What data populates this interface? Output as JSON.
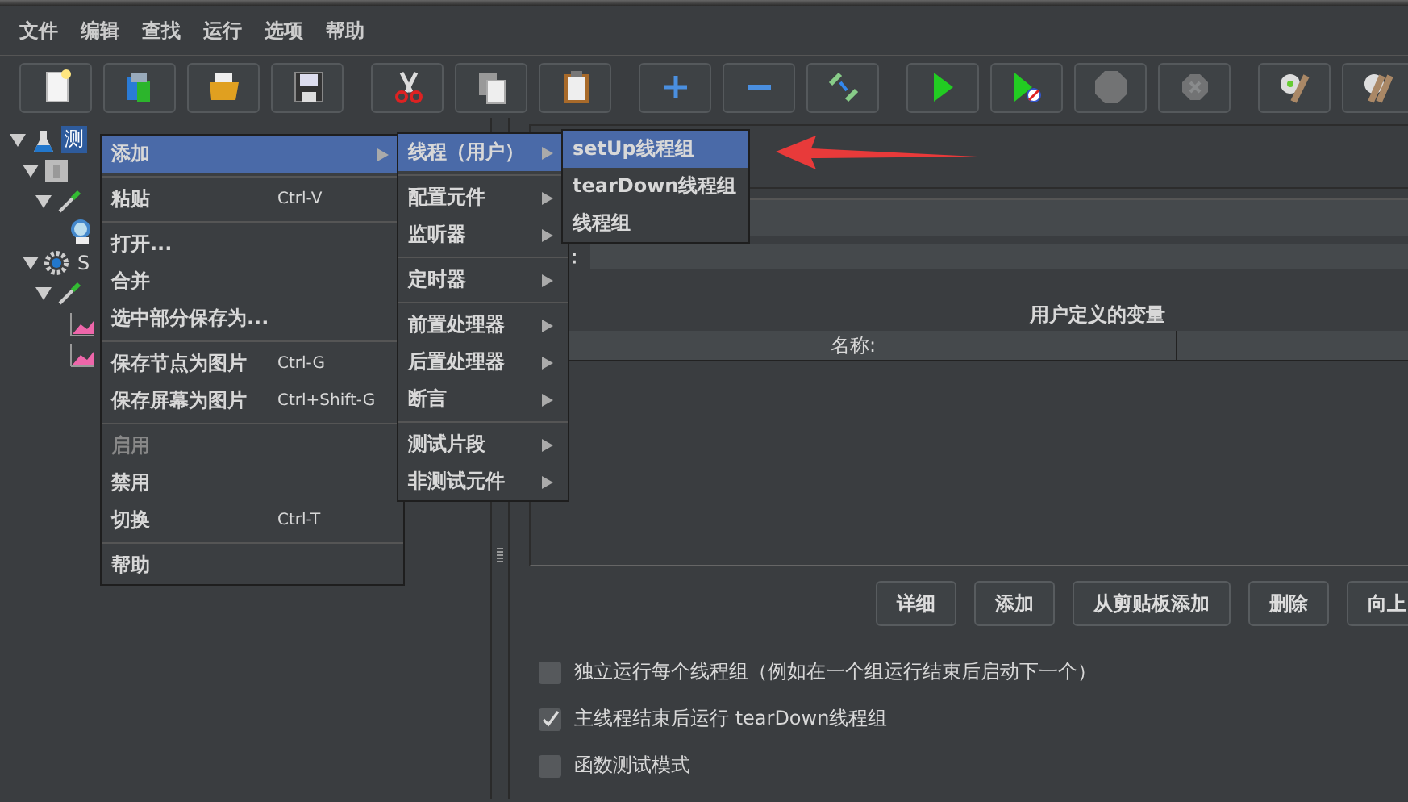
{
  "menu_bar": [
    "文件",
    "编辑",
    "查找",
    "运行",
    "选项",
    "帮助"
  ],
  "toolbar": {
    "groups": [
      [
        {
          "kind": "new",
          "disabled": false
        },
        {
          "kind": "templates",
          "disabled": false
        },
        {
          "kind": "open",
          "disabled": false
        },
        {
          "kind": "save",
          "disabled": false
        }
      ],
      [
        {
          "kind": "cut",
          "disabled": false
        },
        {
          "kind": "copy",
          "disabled": false
        },
        {
          "kind": "paste",
          "disabled": false
        }
      ],
      [
        {
          "kind": "expand",
          "disabled": false
        },
        {
          "kind": "collapse",
          "disabled": false
        },
        {
          "kind": "toggle",
          "disabled": false
        }
      ],
      [
        {
          "kind": "start",
          "disabled": false
        },
        {
          "kind": "start-no-pause",
          "disabled": false
        },
        {
          "kind": "stop",
          "disabled": true
        },
        {
          "kind": "shutdown",
          "disabled": true
        }
      ],
      [
        {
          "kind": "clear",
          "disabled": false
        },
        {
          "kind": "clear-all",
          "disabled": false
        }
      ]
    ]
  },
  "tree": [
    {
      "kind": "plan",
      "label": "测",
      "selected": true,
      "expanded": true,
      "children": [
        {
          "kind": "thread-group",
          "expanded": true,
          "children": [
            {
              "kind": "sampler",
              "expanded": true,
              "children": [
                {
                  "kind": "listener"
                }
              ]
            }
          ]
        },
        {
          "kind": "setup",
          "label": "S",
          "expanded": true,
          "children": [
            {
              "kind": "sampler",
              "expanded": true,
              "children": [
                {
                  "kind": "graph"
                },
                {
                  "kind": "graph"
                }
              ]
            }
          ]
        }
      ]
    }
  ],
  "context_menu": {
    "groups": [
      [
        {
          "label": "添加",
          "selected": true,
          "disabled": false,
          "submenu": true
        }
      ],
      [
        {
          "label": "粘贴",
          "shortcut": "Ctrl-V",
          "selected": false,
          "disabled": false,
          "submenu": false
        }
      ],
      [
        {
          "label": "打开...",
          "selected": false,
          "disabled": false,
          "submenu": false
        },
        {
          "label": "合并",
          "selected": false,
          "disabled": false,
          "submenu": false
        },
        {
          "label": "选中部分保存为...",
          "selected": false,
          "disabled": false,
          "submenu": false
        }
      ],
      [
        {
          "label": "保存节点为图片",
          "shortcut": "Ctrl-G",
          "selected": false,
          "disabled": false,
          "submenu": false
        },
        {
          "label": "保存屏幕为图片",
          "shortcut": "Ctrl+Shift-G",
          "selected": false,
          "disabled": false,
          "submenu": false
        }
      ],
      [
        {
          "label": "启用",
          "selected": false,
          "disabled": true,
          "submenu": false
        },
        {
          "label": "禁用",
          "selected": false,
          "disabled": false,
          "submenu": false
        },
        {
          "label": "切换",
          "shortcut": "Ctrl-T",
          "selected": false,
          "disabled": false,
          "submenu": false
        }
      ],
      [
        {
          "label": "帮助",
          "selected": false,
          "disabled": false,
          "submenu": false
        }
      ]
    ]
  },
  "add_submenu": {
    "groups": [
      [
        {
          "label": "线程（用户）",
          "selected": true,
          "submenu": true
        }
      ],
      [
        {
          "label": "配置元件",
          "selected": false,
          "submenu": true
        },
        {
          "label": "监听器",
          "selected": false,
          "submenu": true
        }
      ],
      [
        {
          "label": "定时器",
          "selected": false,
          "submenu": true
        }
      ],
      [
        {
          "label": "前置处理器",
          "selected": false,
          "submenu": true
        },
        {
          "label": "后置处理器",
          "selected": false,
          "submenu": true
        },
        {
          "label": "断言",
          "selected": false,
          "submenu": true
        }
      ],
      [
        {
          "label": "测试片段",
          "selected": false,
          "submenu": true
        },
        {
          "label": "非测试元件",
          "selected": false,
          "submenu": true
        }
      ]
    ]
  },
  "threads_submenu": {
    "items": [
      {
        "label": "setUp线程组",
        "selected": true
      },
      {
        "label": "tearDown线程组",
        "selected": false
      },
      {
        "label": "线程组",
        "selected": false
      }
    ]
  },
  "annotation": {
    "kind": "arrow",
    "color": "#e83a3a"
  },
  "editor": {
    "comment_label": "：",
    "variables": {
      "title": "用户定义的变量",
      "columns": [
        "名称:"
      ]
    },
    "buttons": [
      "详细",
      "添加",
      "从剪贴板添加",
      "删除",
      "向上"
    ],
    "options": [
      {
        "label": "独立运行每个线程组（例如在一个组运行结束后启动下一个）",
        "checked": false
      },
      {
        "label": "主线程结束后运行 tearDown线程组",
        "checked": true
      },
      {
        "label": "函数测试模式",
        "checked": false
      }
    ]
  }
}
